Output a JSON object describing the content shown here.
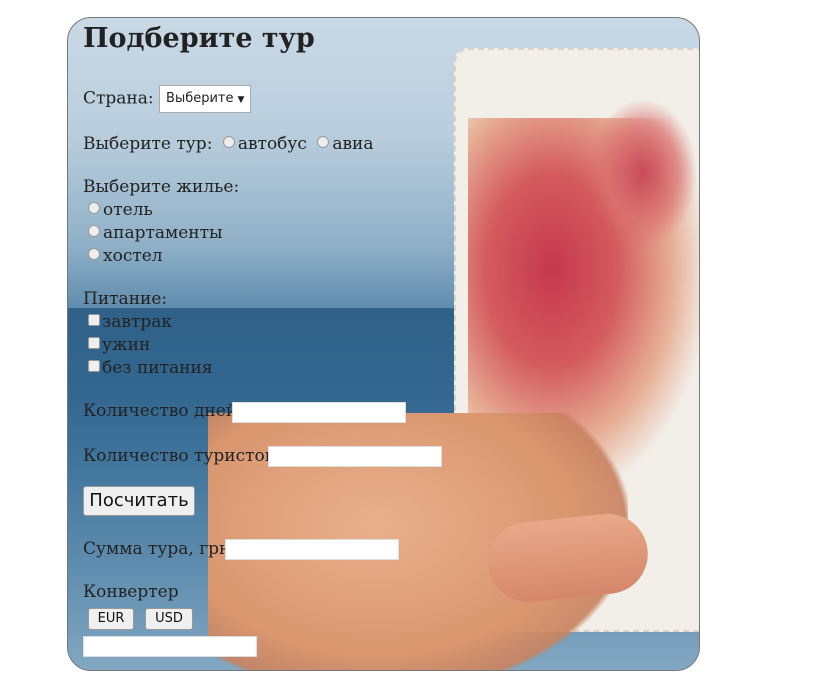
{
  "form": {
    "title": "Подберите тур",
    "country": {
      "label": "Страна:",
      "selected": "Выберите"
    },
    "tour": {
      "label": "Выберите тур:",
      "options": [
        "автобус",
        "авиа"
      ]
    },
    "housing": {
      "label": "Выберите жилье:",
      "options": [
        "отель",
        "апартаменты",
        "хостел"
      ]
    },
    "meals": {
      "label": "Питание:",
      "options": [
        "завтрак",
        "ужин",
        "без питания"
      ]
    },
    "days": {
      "label": "Количество дней",
      "value": ""
    },
    "tourists": {
      "label": "Количество туристов",
      "value": ""
    },
    "calculate_label": "Посчитать",
    "sum": {
      "label": "Сумма тура, грн",
      "value": ""
    },
    "converter": {
      "label": "Конвертер",
      "eur_label": "EUR",
      "usd_label": "USD",
      "value": ""
    }
  }
}
